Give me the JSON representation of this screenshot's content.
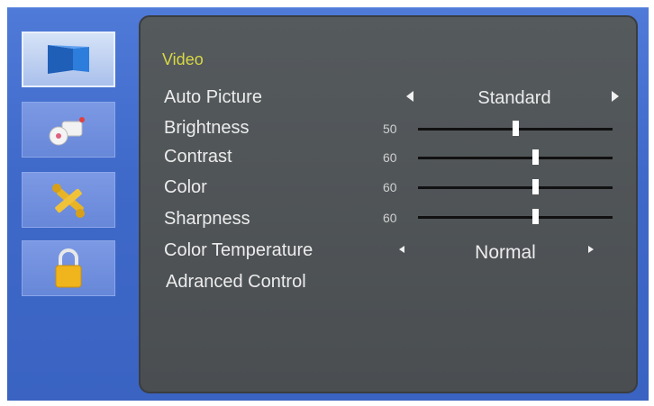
{
  "sidebar": {
    "items": [
      {
        "icon": "picture-icon",
        "selected": true
      },
      {
        "icon": "audio-icon",
        "selected": false
      },
      {
        "icon": "tools-icon",
        "selected": false
      },
      {
        "icon": "lock-icon",
        "selected": false
      }
    ]
  },
  "menu": {
    "title": "Video",
    "auto_picture": {
      "label": "Auto Picture",
      "value": "Standard"
    },
    "brightness": {
      "label": "Brightness",
      "value": 50
    },
    "contrast": {
      "label": "Contrast",
      "value": 60
    },
    "color": {
      "label": "Color",
      "value": 60
    },
    "sharpness": {
      "label": "Sharpness",
      "value": 60
    },
    "color_temperature": {
      "label": "Color Temperature",
      "value": "Normal"
    },
    "advanced": {
      "label": "Adranced Control"
    }
  },
  "colors": {
    "frame_blue": "#3f69c9",
    "panel_gray": "#4f5356",
    "title_yellow": "#d8d844"
  }
}
